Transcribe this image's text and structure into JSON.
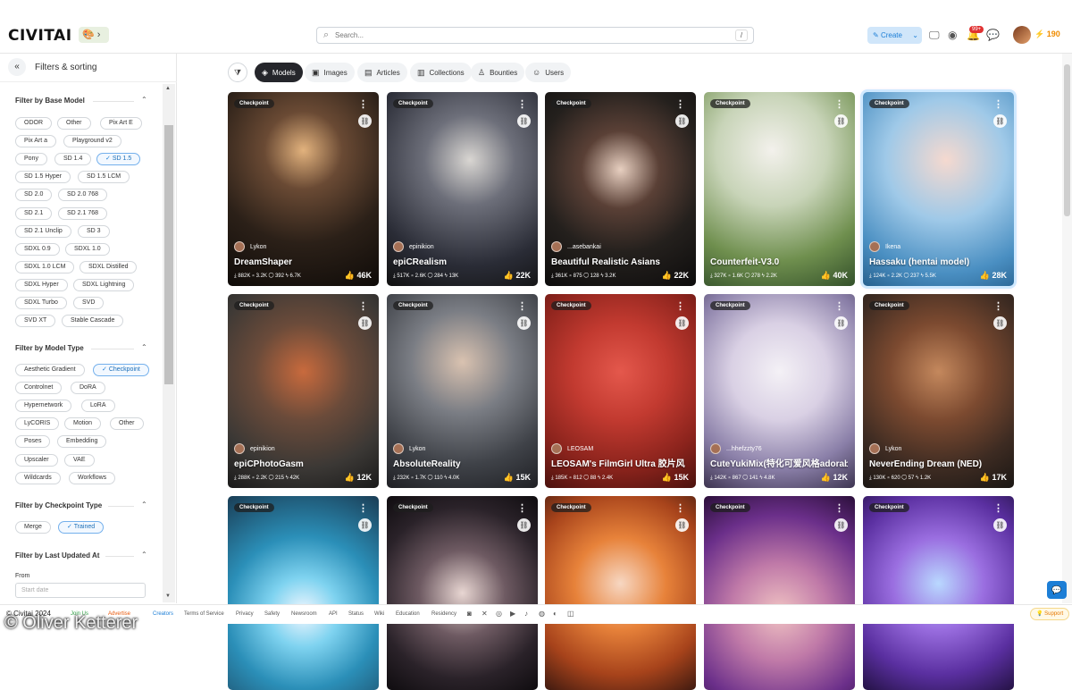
{
  "header": {
    "logo": "CIVITAI",
    "search_placeholder": "Search...",
    "search_shortcut": "/",
    "create_label": "Create",
    "notif_count": "99+",
    "buzz_amount": "190"
  },
  "sidebar": {
    "title": "Filters & sorting",
    "sections": {
      "base_model": "Filter by Base Model",
      "model_type": "Filter by Model Type",
      "checkpoint_type": "Filter by Checkpoint Type",
      "last_updated": "Filter by Last Updated At"
    },
    "base_models": [
      "ODOR",
      "Other",
      "Pix Art E",
      "Pix Art a",
      "Playground v2",
      "Pony",
      "SD 1.4",
      "SD 1.5",
      "SD 1.5 Hyper",
      "SD 1.5 LCM",
      "SD 2.0",
      "SD 2.0 768",
      "SD 2.1",
      "SD 2.1 768",
      "SD 2.1 Unclip",
      "SD 3",
      "SDXL 0.9",
      "SDXL 1.0",
      "SDXL 1.0 LCM",
      "SDXL Distilled",
      "SDXL Hyper",
      "SDXL Lightning",
      "SDXL Turbo",
      "SVD",
      "SVD XT",
      "Stable Cascade"
    ],
    "model_types": [
      "Aesthetic Gradient",
      "Checkpoint",
      "Controlnet",
      "DoRA",
      "Hypernetwork",
      "LoRA",
      "LyCORIS",
      "Motion",
      "Other",
      "Poses",
      "Embedding",
      "Upscaler",
      "VAE",
      "Wildcards",
      "Workflows"
    ],
    "checkpoint_types": [
      "Merge",
      "Trained"
    ],
    "from_label": "From",
    "date_placeholder": "Start date"
  },
  "tabs": [
    "Models",
    "Images",
    "Articles",
    "Collections",
    "Bounties",
    "Users"
  ],
  "cards": [
    {
      "badge": "Checkpoint",
      "creator": "Lykon",
      "name": "DreamShaper",
      "stats": "⤓ 882K  ⌑ 3.2K  ◯ 392  ϟ 6.7K",
      "likes": "46K"
    },
    {
      "badge": "Checkpoint",
      "creator": "epinikion",
      "name": "epiCRealism",
      "stats": "⤓ 517K  ⌑ 2.6K  ◯ 284  ϟ 13K",
      "likes": "22K"
    },
    {
      "badge": "Checkpoint",
      "creator": "...asebankai",
      "name": "Beautiful Realistic Asians",
      "stats": "⤓ 361K  ⌑ 875  ◯ 128  ϟ 3.2K",
      "likes": "22K"
    },
    {
      "badge": "Checkpoint",
      "creator": "",
      "name": "Counterfeit-V3.0",
      "stats": "⤓ 327K  ⌑ 1.6K  ◯ 278  ϟ 2.2K",
      "likes": "40K"
    },
    {
      "badge": "Checkpoint",
      "creator": "Ikena",
      "name": "Hassaku (hentai model)",
      "stats": "⤓ 124K  ⌑ 2.2K  ◯ 237  ϟ 5.5K",
      "likes": "28K"
    },
    {
      "badge": "Checkpoint",
      "creator": "epinikion",
      "name": "epiCPhotoGasm",
      "stats": "⤓ 288K  ⌑ 2.2K  ◯ 215  ϟ 42K",
      "likes": "12K"
    },
    {
      "badge": "Checkpoint",
      "creator": "Lykon",
      "name": "AbsoluteReality",
      "stats": "⤓ 232K  ⌑ 1.7K  ◯ 110  ϟ 4.0K",
      "likes": "15K"
    },
    {
      "badge": "Checkpoint",
      "creator": "LEOSAM",
      "name": "LEOSAM's FilmGirl Ultra 胶片风",
      "stats": "⤓ 185K  ⌑ 812  ◯ 88  ϟ 2.4K",
      "likes": "15K"
    },
    {
      "badge": "Checkpoint",
      "creator": "...hhefzzty76",
      "name": "CuteYukiMix(特化可爱风格adorable style)",
      "stats": "⤓ 142K  ⌑ 867  ◯ 141  ϟ 4.8K",
      "likes": "12K"
    },
    {
      "badge": "Checkpoint",
      "creator": "Lykon",
      "name": "NeverEnding Dream (NED)",
      "stats": "⤓ 130K  ⌑ 620  ◯ 57  ϟ 1.2K",
      "likes": "17K"
    },
    {
      "badge": "Checkpoint",
      "creator": "",
      "name": "",
      "stats": "",
      "likes": ""
    },
    {
      "badge": "Checkpoint",
      "creator": "",
      "name": "",
      "stats": "",
      "likes": ""
    },
    {
      "badge": "Checkpoint",
      "creator": "",
      "name": "",
      "stats": "",
      "likes": ""
    },
    {
      "badge": "Checkpoint",
      "creator": "",
      "name": "",
      "stats": "",
      "likes": ""
    },
    {
      "badge": "Checkpoint",
      "creator": "",
      "name": "",
      "stats": "",
      "likes": ""
    }
  ],
  "footer": {
    "copyright": "© Civitai 2024",
    "links": [
      "Join Us",
      "Advertise",
      "Creators",
      "Terms of Service",
      "Privacy",
      "Safety",
      "Newsroom",
      "API",
      "Status",
      "Wiki",
      "Education",
      "Residency"
    ],
    "support": "Support"
  },
  "watermark": "© Oliver Ketterer",
  "colors": {
    "accent": "#1c7ed6",
    "dark_tab": "#25262b",
    "like": "#fab005"
  }
}
